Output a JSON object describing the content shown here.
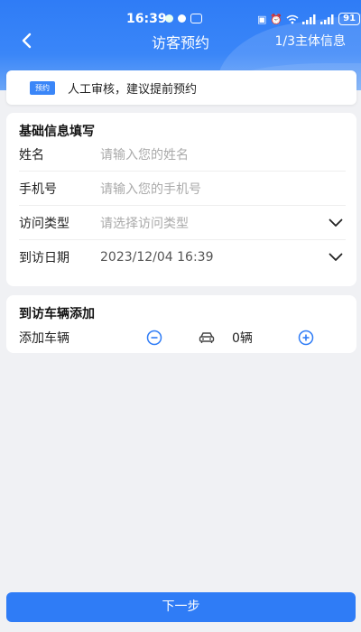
{
  "status_bar": {
    "time": "16:39",
    "battery": "91"
  },
  "nav": {
    "title": "访客预约",
    "step": "1/3主体信息"
  },
  "notice": {
    "badge": "预约",
    "text": "人工审核，建议提前预约"
  },
  "basic_info": {
    "title": "基础信息填写",
    "fields": [
      {
        "label": "姓名",
        "placeholder": "请输入您的姓名",
        "value": ""
      },
      {
        "label": "手机号",
        "placeholder": "请输入您的手机号",
        "value": ""
      },
      {
        "label": "访问类型",
        "placeholder": "请选择访问类型",
        "value": ""
      },
      {
        "label": "到访日期",
        "placeholder": "",
        "value": "2023/12/04 16:39"
      }
    ]
  },
  "vehicle": {
    "title": "到访车辆添加",
    "label": "添加车辆",
    "count": "0辆"
  },
  "footer": {
    "next_label": "下一步"
  },
  "colors": {
    "primary": "#2f7cf6",
    "background": "#f0f1f4"
  },
  "icons": [
    "back-arrow-icon",
    "chevron-down-icon",
    "minus-circle-icon",
    "car-icon",
    "plus-circle-icon"
  ]
}
